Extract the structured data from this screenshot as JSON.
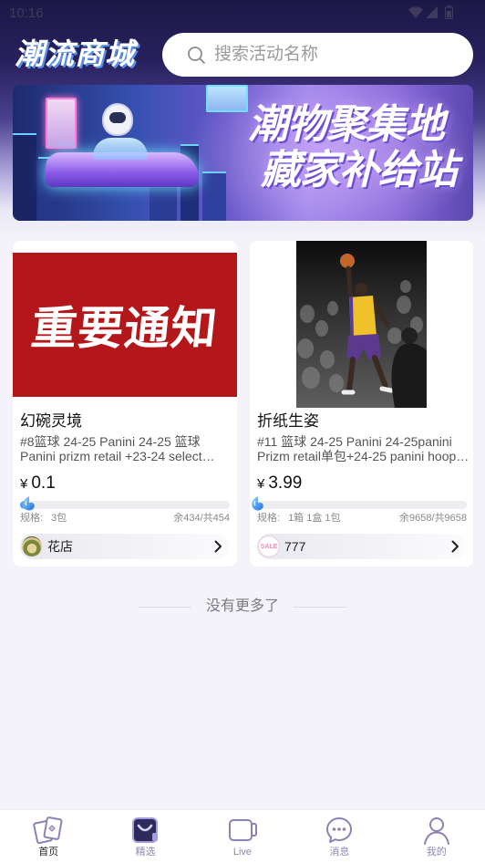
{
  "status_bar": {
    "time": "10:16",
    "icons": [
      "wifi-icon",
      "signal-icon",
      "battery-icon"
    ]
  },
  "header": {
    "logo_text": "潮流商城",
    "search": {
      "placeholder": "搜索活动名称",
      "value": "",
      "icon": "search-icon"
    }
  },
  "banner": {
    "headline_line1": "潮物聚集地",
    "headline_line2": "藏家补给站"
  },
  "products": [
    {
      "image_text": "重要通知",
      "title": "幻碗灵境",
      "description": "#8篮球 24-25 Panini 24-25 篮球 Panini prizm retail +23-24 select…",
      "currency": "¥",
      "price": "0.1",
      "progress": 0.04,
      "spec_label": "规格:",
      "spec_value": "3包",
      "stock": "余434/共454",
      "shop": {
        "name": "花店",
        "avatar_icon": "shop-avatar"
      }
    },
    {
      "title": "折纸生姿",
      "description": "#11 篮球 24-25 Panini 24-25panini Prizm retail单包+24-25 panini hoop…",
      "currency": "¥",
      "price": "3.99",
      "progress": 0,
      "spec_label": "规格:",
      "spec_value": "1箱 1盒 1包",
      "stock": "余9658/共9658",
      "shop": {
        "name": "777",
        "avatar_text": "SALE"
      }
    }
  ],
  "list_end_text": "没有更多了",
  "tabbar": {
    "items": [
      {
        "label": "首页",
        "icon": "cards-icon",
        "active": true
      },
      {
        "label": "精选",
        "icon": "shopping-bag-icon",
        "active": false
      },
      {
        "label": "Live",
        "icon": "tv-icon",
        "active": false
      },
      {
        "label": "消息",
        "icon": "chat-bubble-icon",
        "active": false
      },
      {
        "label": "我的",
        "icon": "user-icon",
        "active": false
      }
    ]
  },
  "colors": {
    "header_bg": "#1c1846",
    "page_bg": "#f3f3f9",
    "accent": "#8a84b4",
    "notice_red": "#b3171a",
    "progress_blue": "#3a8ef0"
  }
}
